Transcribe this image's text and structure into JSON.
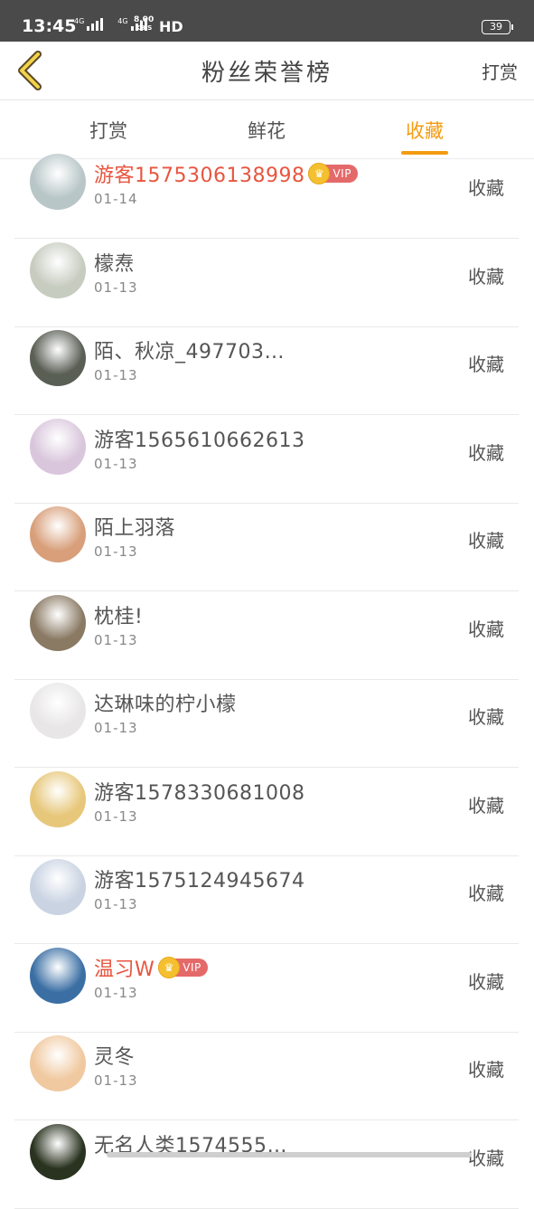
{
  "status_bar": {
    "time": "13:45",
    "net1": "4G",
    "net2": "4G",
    "speed_value": "8.00",
    "speed_unit": "KB/S",
    "hd": "HD",
    "battery": "39"
  },
  "header": {
    "title": "粉丝荣誉榜",
    "right_link": "打赏"
  },
  "tabs": [
    {
      "label": "打赏",
      "active": false
    },
    {
      "label": "鲜花",
      "active": false
    },
    {
      "label": "收藏",
      "active": true
    }
  ],
  "accent_color": "#f39c12",
  "vip_name_color": "#e8553f",
  "vip_label": "VIP",
  "rows": [
    {
      "name": "游客1575306138998",
      "date": "01-14",
      "action": "收藏",
      "vip": true,
      "avatar_color": "#b8c6c8"
    },
    {
      "name": "檬焘",
      "date": "01-13",
      "action": "收藏",
      "vip": false,
      "avatar_color": "#c7ccc0"
    },
    {
      "name": "陌、秋凉_497703…",
      "date": "01-13",
      "action": "收藏",
      "vip": false,
      "avatar_color": "#5a5f55"
    },
    {
      "name": "游客1565610662613",
      "date": "01-13",
      "action": "收藏",
      "vip": false,
      "avatar_color": "#d9c6dc"
    },
    {
      "name": "陌上羽落",
      "date": "01-13",
      "action": "收藏",
      "vip": false,
      "avatar_color": "#d89f7a"
    },
    {
      "name": "枕桂!",
      "date": "01-13",
      "action": "收藏",
      "vip": false,
      "avatar_color": "#8a7a64"
    },
    {
      "name": "达琳味的柠小檬",
      "date": "01-13",
      "action": "收藏",
      "vip": false,
      "avatar_color": "#e8e6e6"
    },
    {
      "name": "游客1578330681008",
      "date": "01-13",
      "action": "收藏",
      "vip": false,
      "avatar_color": "#e7c77a"
    },
    {
      "name": "游客1575124945674",
      "date": "01-13",
      "action": "收藏",
      "vip": false,
      "avatar_color": "#c9d3e2"
    },
    {
      "name": "温习W",
      "date": "01-13",
      "action": "收藏",
      "vip": true,
      "avatar_color": "#3b6fa4"
    },
    {
      "name": "灵冬",
      "date": "01-13",
      "action": "收藏",
      "vip": false,
      "avatar_color": "#f0c9a0"
    },
    {
      "name": "无名人类1574555…",
      "date": "",
      "action": "收藏",
      "vip": false,
      "avatar_color": "#2a3320"
    }
  ]
}
